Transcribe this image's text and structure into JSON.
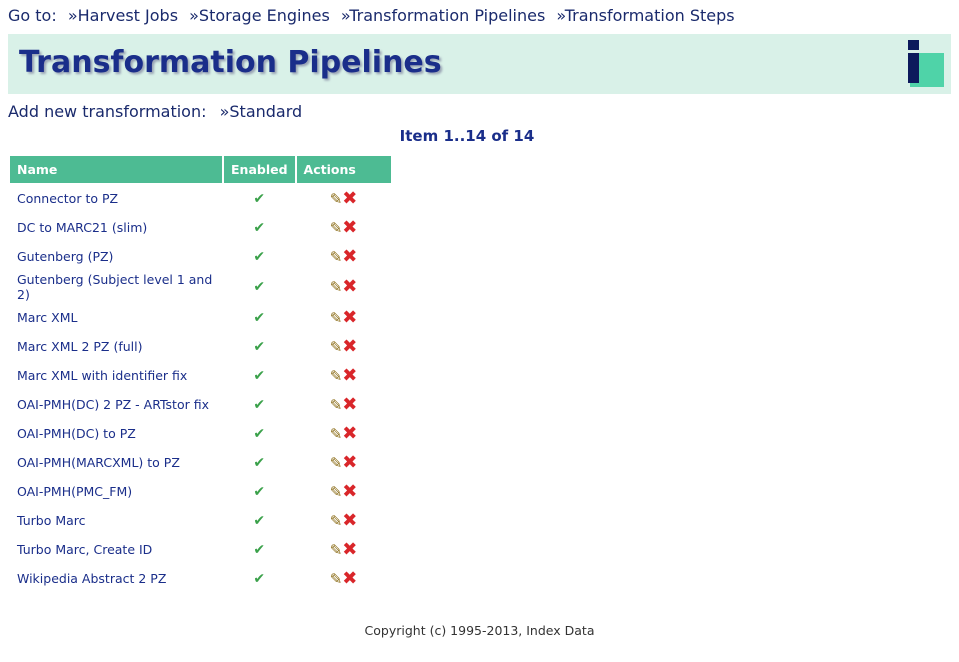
{
  "nav": {
    "label": "Go to:",
    "links": [
      "»Harvest Jobs",
      "»Storage Engines",
      "»Transformation Pipelines",
      "»Transformation Steps"
    ]
  },
  "page": {
    "title": "Transformation Pipelines"
  },
  "add_new": {
    "label": "Add new transformation:",
    "standard": "»Standard"
  },
  "pager": {
    "text": "Item 1..14 of 14"
  },
  "table": {
    "columns": [
      "Name",
      "Enabled",
      "Actions"
    ],
    "rows": [
      {
        "name": "Connector to PZ",
        "enabled": "✔"
      },
      {
        "name": "DC to MARC21 (slim)",
        "enabled": "✔"
      },
      {
        "name": "Gutenberg (PZ)",
        "enabled": "✔"
      },
      {
        "name": "Gutenberg (Subject level 1 and 2)",
        "enabled": "✔"
      },
      {
        "name": "Marc XML",
        "enabled": "✔"
      },
      {
        "name": "Marc XML 2 PZ (full)",
        "enabled": "✔"
      },
      {
        "name": "Marc XML with identifier fix",
        "enabled": "✔"
      },
      {
        "name": "OAI-PMH(DC) 2 PZ - ARTstor fix",
        "enabled": "✔"
      },
      {
        "name": "OAI-PMH(DC) to PZ",
        "enabled": "✔"
      },
      {
        "name": "OAI-PMH(MARCXML) to PZ",
        "enabled": "✔"
      },
      {
        "name": "OAI-PMH(PMC_FM)",
        "enabled": "✔"
      },
      {
        "name": "Turbo Marc",
        "enabled": "✔"
      },
      {
        "name": "Turbo Marc, Create ID",
        "enabled": "✔"
      },
      {
        "name": "Wikipedia Abstract 2 PZ",
        "enabled": "✔"
      }
    ],
    "icons": {
      "enabled": "check-icon",
      "edit": "pencil-icon",
      "delete": "delete-x-icon"
    }
  },
  "icon_glyphs": {
    "edit": "✎",
    "delete": "✖"
  },
  "footer": {
    "copyright": "Copyright (c) 1995-2013, Index Data"
  },
  "colors": {
    "header_bg": "#4dbb93",
    "banner_bg": "#d9f1e8",
    "logo_accent": "#4fd3a8",
    "text": "#1a2a6c"
  }
}
